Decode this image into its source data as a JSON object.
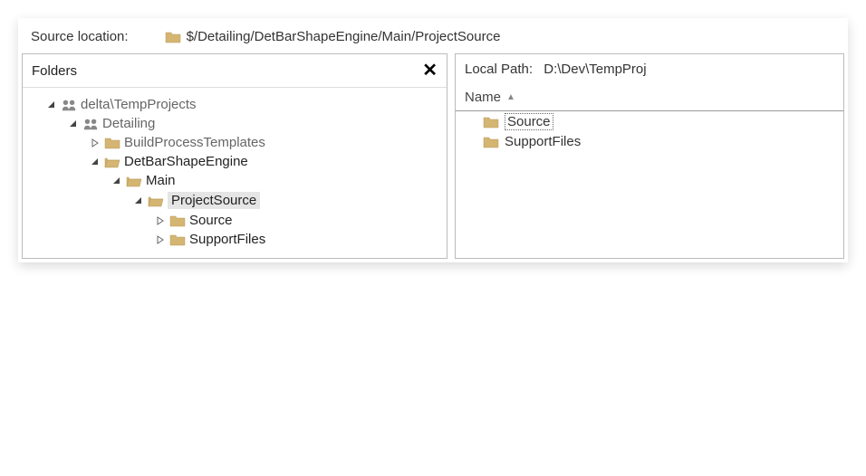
{
  "sourceLocation": {
    "label": "Source location:",
    "path": "$/Detailing/DetBarShapeEngine/Main/ProjectSource"
  },
  "foldersPanel": {
    "title": "Folders",
    "tree": {
      "root": "delta\\TempProjects",
      "detailing": "Detailing",
      "buildProcessTemplates": "BuildProcessTemplates",
      "detBarShapeEngine": "DetBarShapeEngine",
      "main": "Main",
      "projectSource": "ProjectSource",
      "source": "Source",
      "supportFiles": "SupportFiles"
    }
  },
  "localPathPanel": {
    "label": "Local Path:",
    "value": "D:\\Dev\\TempProj",
    "nameHeader": "Name",
    "items": {
      "source": "Source",
      "supportFiles": "SupportFiles"
    }
  }
}
